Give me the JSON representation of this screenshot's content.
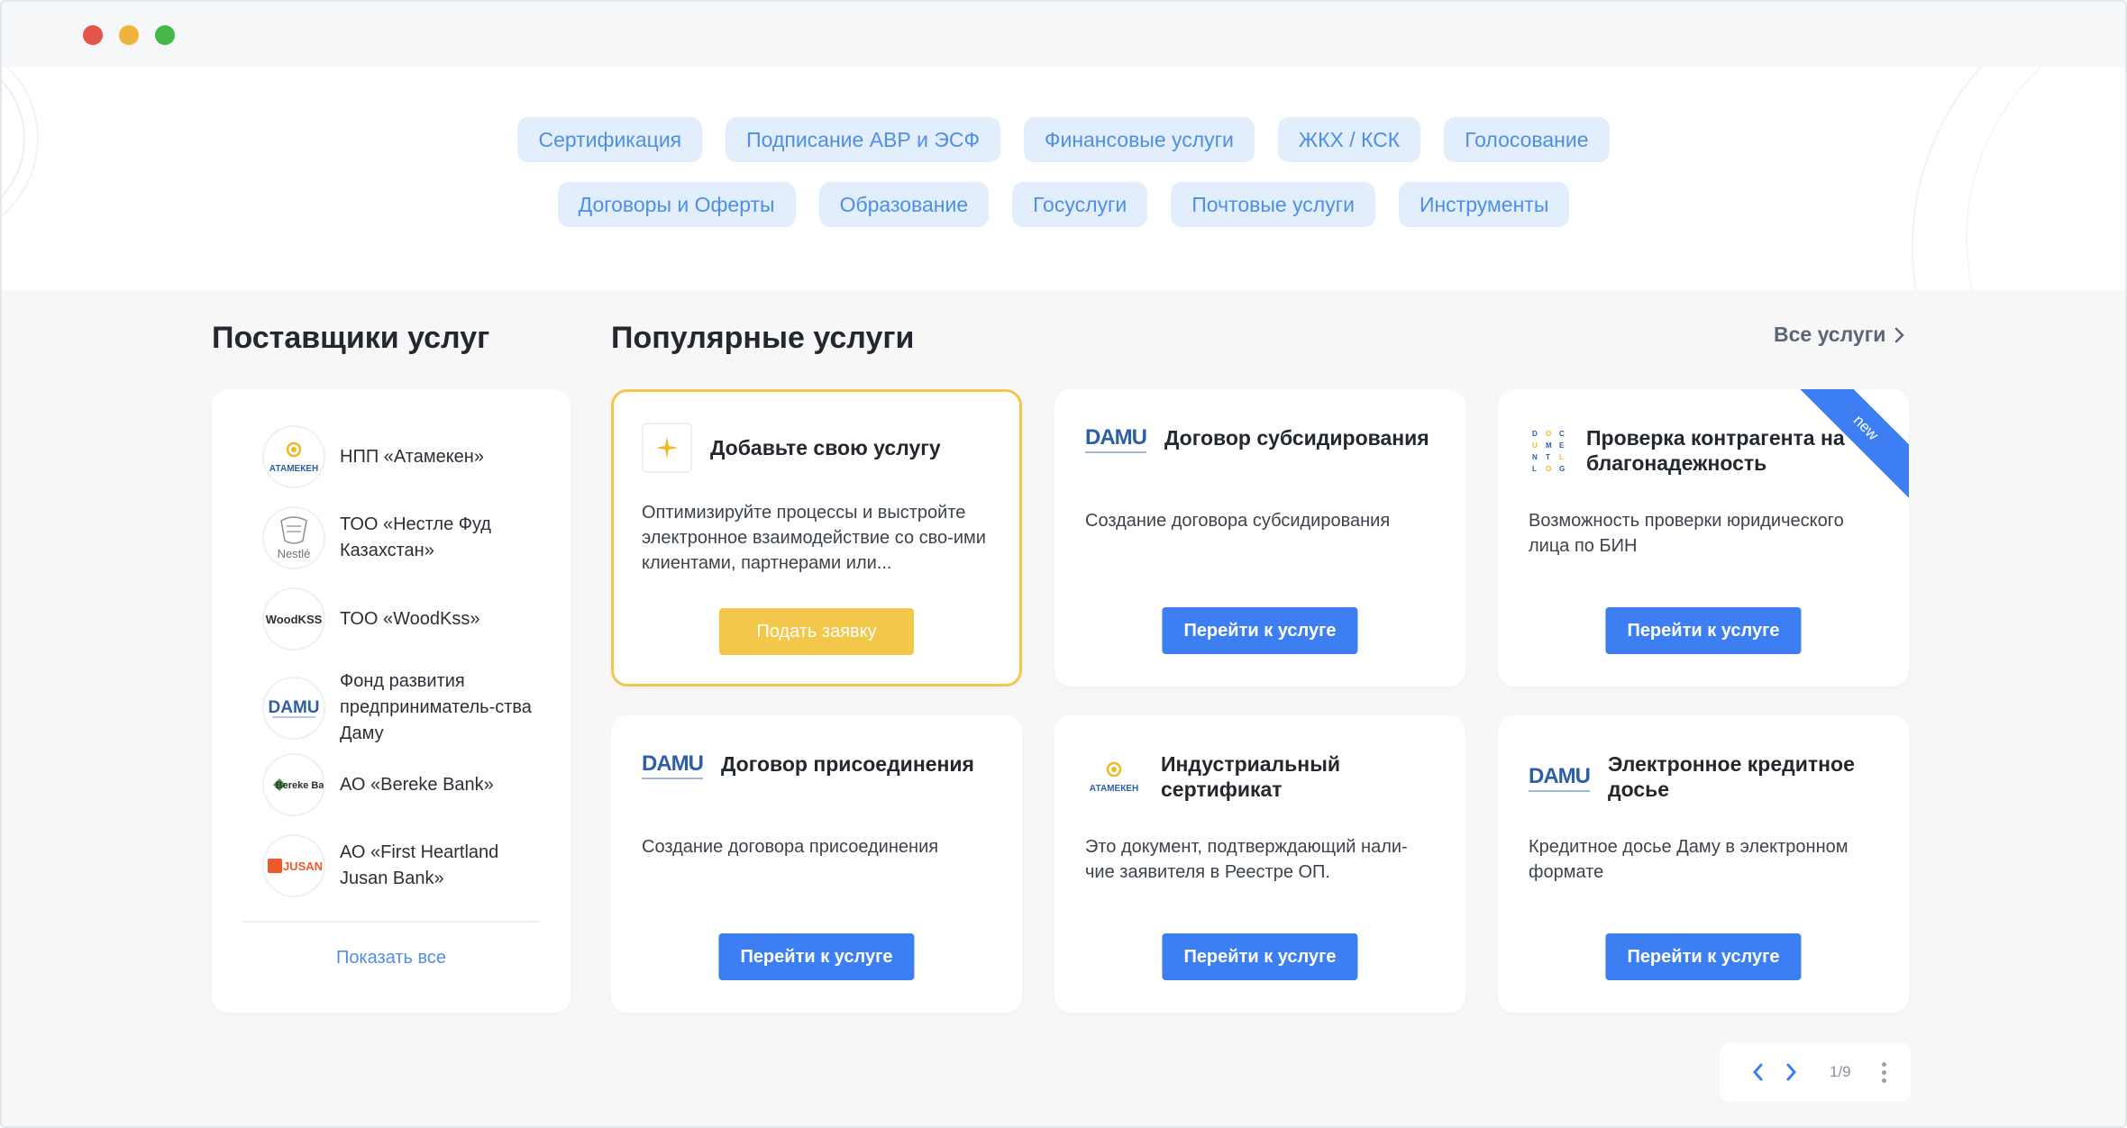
{
  "chips": {
    "row1": [
      "Сертификация",
      "Подписание АВР и ЭСФ",
      "Финансовые услуги",
      "ЖКХ / КСК",
      "Голосование"
    ],
    "row2": [
      "Договоры и Оферты",
      "Образование",
      "Госуслуги",
      "Почтовые услуги",
      "Инструменты"
    ]
  },
  "providers": {
    "title": "Поставщики услуг",
    "items": [
      {
        "name": "НПП «Атамекен»",
        "logo_text": "АТАМЕКЕН"
      },
      {
        "name": "ТОО «Нестле Фуд Казахстан»",
        "logo_text": "Nestlé"
      },
      {
        "name": "ТОО «WoodKss»",
        "logo_text": "WoodKSS"
      },
      {
        "name": "Фонд развития предприниматель-ства Даму",
        "logo_text": "DAMU"
      },
      {
        "name": "АО «Bereke Bank»",
        "logo_text": "Bereke Bank"
      },
      {
        "name": "АО «First Heartland Jusan Bank»",
        "logo_text": "JUSAN"
      }
    ],
    "show_all": "Показать все"
  },
  "popular": {
    "title": "Популярные услуги",
    "all_link": "Все услуги",
    "cards": [
      {
        "title": "Добавьте свою услугу",
        "desc": "Оптимизируйте процессы и выстройте электронное взаимодействие со сво-ими клиентами, партнерами или...",
        "button": "Подать заявку",
        "logo": "sparkle-icon"
      },
      {
        "title": "Договор субсидирования",
        "desc": "Создание договора субсидирования",
        "button": "Перейти к услуге",
        "logo_text": "DAMU"
      },
      {
        "title": "Проверка контрагента на благонадежность",
        "desc": "Возможность проверки юридического лица по БИН",
        "button": "Перейти к услуге",
        "logo_text": "DOCUMENTLOG",
        "ribbon": "new"
      },
      {
        "title": "Договор присоединения",
        "desc": "Создание договора присоединения",
        "button": "Перейти к услуге",
        "logo_text": "DAMU"
      },
      {
        "title": "Индустриальный сертификат",
        "desc": "Это документ, подтверждающий нали-чие заявителя в Реестре ОП.",
        "button": "Перейти к услуге",
        "logo_text": "АТАМЕКЕН"
      },
      {
        "title": "Электронное кредитное досье",
        "desc": "Кредитное досье Даму в электронном формате",
        "button": "Перейти к услуге",
        "logo_text": "DAMU"
      }
    ]
  },
  "pager": {
    "count": "1/9"
  },
  "colors": {
    "accent": "#3d7ff2",
    "chip_bg": "#e3eefc",
    "chip_text": "#4d8fe6",
    "highlight": "#f3c84a"
  }
}
